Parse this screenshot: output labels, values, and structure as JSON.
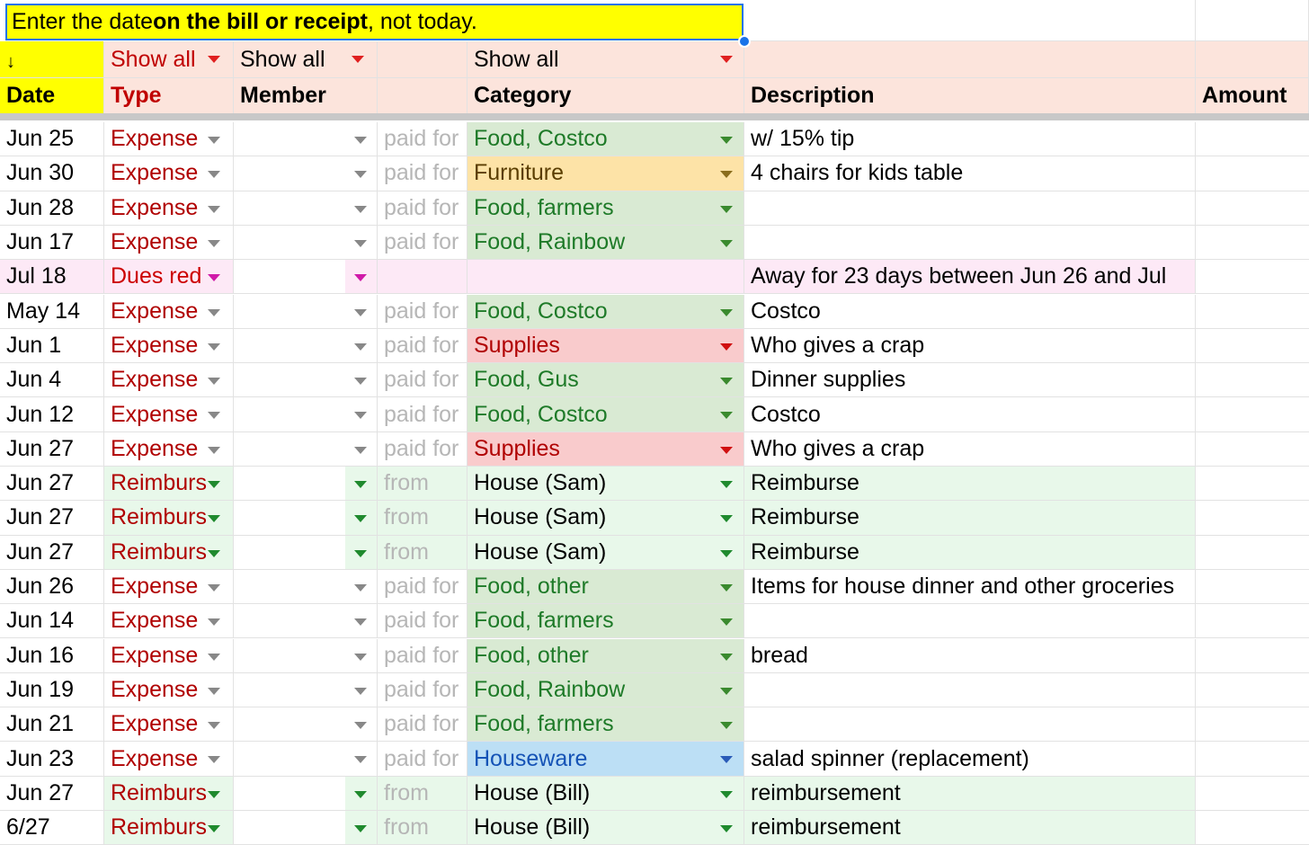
{
  "tooltip": {
    "prefix": "Enter the date ",
    "bold": "on the bill or receipt",
    "suffix": ", not today."
  },
  "filters": {
    "date_icon": "↓",
    "type": "Show all",
    "member": "Show all",
    "category": "Show all"
  },
  "headers": {
    "date": "Date",
    "type": "Type",
    "member": "Member",
    "category": "Category",
    "description": "Description",
    "amount": "Amount"
  },
  "colors": {
    "header_bg": "#fce4dc",
    "date_header_bg": "#ffff00",
    "expense_cat_green": "#d9ead3",
    "furniture": "#fde3a7",
    "supplies": "#f9cbcc",
    "houseware": "#bcdff5",
    "reimburse_bg": "#e8f8ea",
    "dues_bg": "#fde9f6"
  },
  "rows": [
    {
      "date": "Jun 25",
      "type": "Expense",
      "kind": "expense",
      "rel": "paid for",
      "category": "Food, Costco",
      "cat": "green",
      "description": "w/ 15% tip"
    },
    {
      "date": "Jun 30",
      "type": "Expense",
      "kind": "expense",
      "rel": "paid for",
      "category": "Furniture",
      "cat": "orange",
      "description": "4 chairs for kids table"
    },
    {
      "date": "Jun 28",
      "type": "Expense",
      "kind": "expense",
      "rel": "paid for",
      "category": "Food, farmers",
      "cat": "green",
      "description": ""
    },
    {
      "date": "Jun 17",
      "type": "Expense",
      "kind": "expense",
      "rel": "paid for",
      "category": "Food, Rainbow",
      "cat": "green",
      "description": ""
    },
    {
      "date": "Jul 18",
      "type": "Dues red",
      "kind": "dues",
      "rel": "",
      "category": "",
      "cat": "none",
      "description": "Away for 23 days between Jun 26 and Jul"
    },
    {
      "date": "May 14",
      "type": "Expense",
      "kind": "expense",
      "rel": "paid for",
      "category": "Food, Costco",
      "cat": "green",
      "description": "Costco"
    },
    {
      "date": "Jun 1",
      "type": "Expense",
      "kind": "expense",
      "rel": "paid for",
      "category": "Supplies",
      "cat": "red",
      "description": "Who gives a crap"
    },
    {
      "date": "Jun 4",
      "type": "Expense",
      "kind": "expense",
      "rel": "paid for",
      "category": "Food, Gus",
      "cat": "green",
      "description": "Dinner supplies"
    },
    {
      "date": "Jun 12",
      "type": "Expense",
      "kind": "expense",
      "rel": "paid for",
      "category": "Food, Costco",
      "cat": "green",
      "description": "Costco"
    },
    {
      "date": "Jun 27",
      "type": "Expense",
      "kind": "expense",
      "rel": "paid for",
      "category": "Supplies",
      "cat": "red",
      "description": "Who gives a crap"
    },
    {
      "date": "Jun 27",
      "type": "Reimburs",
      "kind": "reimburse",
      "rel": "from",
      "category": "House (Sam)",
      "cat": "plain",
      "description": "Reimburse"
    },
    {
      "date": "Jun 27",
      "type": "Reimburs",
      "kind": "reimburse",
      "rel": "from",
      "category": "House (Sam)",
      "cat": "plain",
      "description": "Reimburse"
    },
    {
      "date": "Jun 27",
      "type": "Reimburs",
      "kind": "reimburse",
      "rel": "from",
      "category": "House (Sam)",
      "cat": "plain",
      "description": "Reimburse"
    },
    {
      "date": "Jun 26",
      "type": "Expense",
      "kind": "expense",
      "rel": "paid for",
      "category": "Food, other",
      "cat": "green",
      "description": "Items for house dinner and other groceries"
    },
    {
      "date": "Jun 14",
      "type": "Expense",
      "kind": "expense",
      "rel": "paid for",
      "category": "Food, farmers",
      "cat": "green",
      "description": ""
    },
    {
      "date": "Jun 16",
      "type": "Expense",
      "kind": "expense",
      "rel": "paid for",
      "category": "Food, other",
      "cat": "green",
      "description": "bread"
    },
    {
      "date": "Jun 19",
      "type": "Expense",
      "kind": "expense",
      "rel": "paid for",
      "category": "Food, Rainbow",
      "cat": "green",
      "description": ""
    },
    {
      "date": "Jun 21",
      "type": "Expense",
      "kind": "expense",
      "rel": "paid for",
      "category": "Food, farmers",
      "cat": "green",
      "description": ""
    },
    {
      "date": "Jun 23",
      "type": "Expense",
      "kind": "expense",
      "rel": "paid for",
      "category": "Houseware",
      "cat": "blue",
      "description": "salad spinner (replacement)"
    },
    {
      "date": "Jun 27",
      "type": "Reimburs",
      "kind": "reimburse",
      "rel": "from",
      "category": "House (Bill)",
      "cat": "plain",
      "description": "reimbursement"
    },
    {
      "date": "6/27",
      "type": "Reimburs",
      "kind": "reimburse",
      "rel": "from",
      "category": "House (Bill)",
      "cat": "plain",
      "description": "reimbursement"
    }
  ]
}
